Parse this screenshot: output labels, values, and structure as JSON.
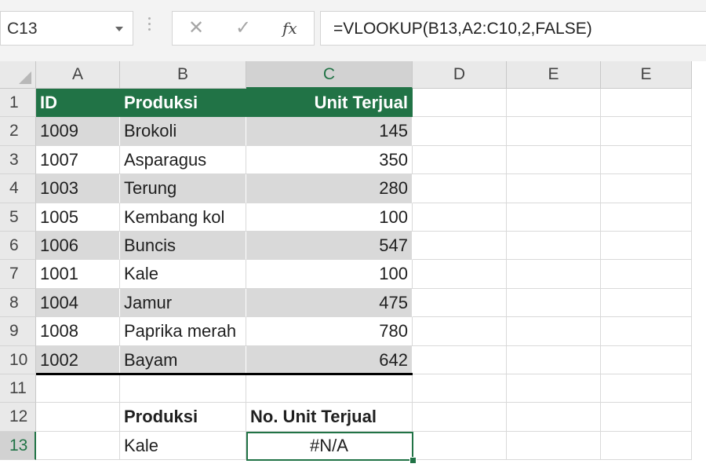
{
  "formula_bar": {
    "name_box": "C13",
    "cancel_icon": "✕",
    "enter_icon": "✓",
    "fx_label": "fx",
    "formula": "=VLOOKUP(B13,A2:C10,2,FALSE)"
  },
  "columns": [
    "A",
    "B",
    "C",
    "D",
    "E",
    "E"
  ],
  "rows": [
    "1",
    "2",
    "3",
    "4",
    "5",
    "6",
    "7",
    "8",
    "9",
    "10",
    "11",
    "12",
    "13"
  ],
  "table": {
    "headers": [
      "ID",
      "Produksi",
      "Unit Terjual"
    ],
    "data": [
      [
        "1009",
        "Brokoli",
        "145"
      ],
      [
        "1007",
        "Asparagus",
        "350"
      ],
      [
        "1003",
        "Terung",
        "280"
      ],
      [
        "1005",
        "Kembang kol",
        "100"
      ],
      [
        "1006",
        "Buncis",
        "547"
      ],
      [
        "1001",
        "Kale",
        "100"
      ],
      [
        "1004",
        "Jamur",
        "475"
      ],
      [
        "1008",
        "Paprika merah",
        "780"
      ],
      [
        "1002",
        "Bayam",
        "642"
      ]
    ]
  },
  "lookup": {
    "label_produksi": "Produksi",
    "label_units": "No. Unit Terjual",
    "value_produksi": "Kale",
    "result": "#N/A"
  },
  "colors": {
    "accent": "#217346",
    "band": "#d9d9d9"
  }
}
